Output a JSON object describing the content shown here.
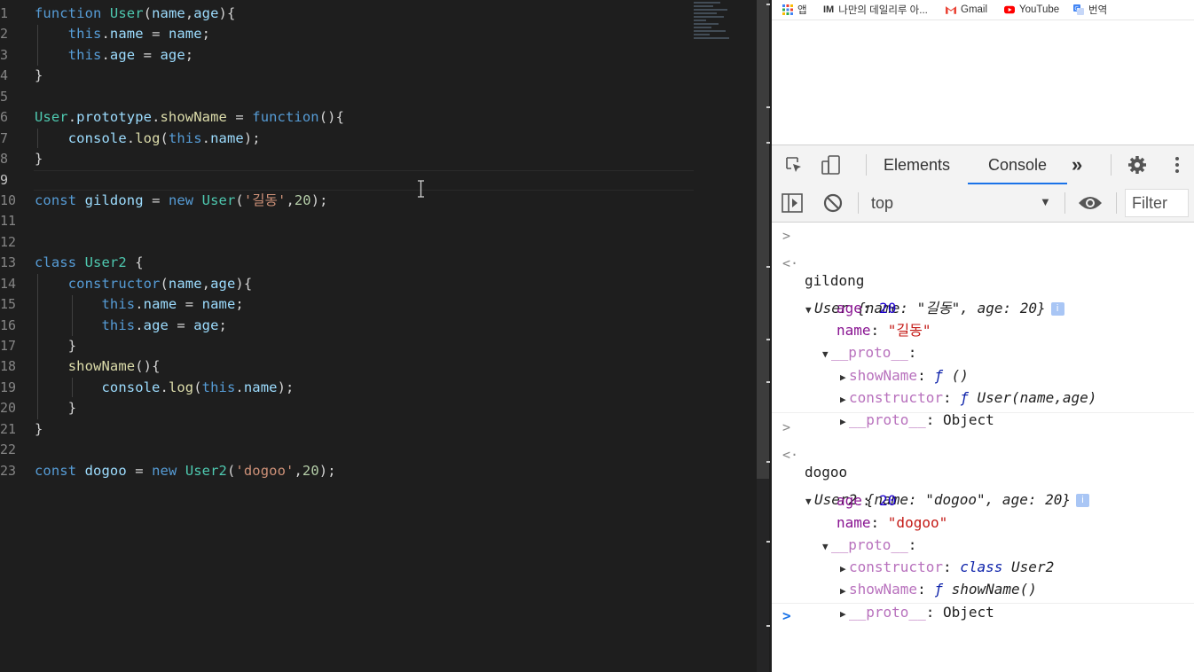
{
  "editor": {
    "line_numbers": [
      "1",
      "2",
      "3",
      "4",
      "5",
      "6",
      "7",
      "8",
      "9",
      "10",
      "11",
      "12",
      "13",
      "14",
      "15",
      "16",
      "17",
      "18",
      "19",
      "20",
      "21",
      "22",
      "23"
    ],
    "lines": [
      [
        [
          "kw",
          "function"
        ],
        [
          "t",
          " "
        ],
        [
          "cls",
          "User"
        ],
        [
          "t",
          "("
        ],
        [
          "var",
          "name"
        ],
        [
          "t",
          ","
        ],
        [
          "var",
          "age"
        ],
        [
          "t",
          "){"
        ]
      ],
      [
        [
          "t",
          "    "
        ],
        [
          "kw",
          "this"
        ],
        [
          "t",
          "."
        ],
        [
          "var",
          "name"
        ],
        [
          "t",
          " = "
        ],
        [
          "var",
          "name"
        ],
        [
          "t",
          ";"
        ]
      ],
      [
        [
          "t",
          "    "
        ],
        [
          "kw",
          "this"
        ],
        [
          "t",
          "."
        ],
        [
          "var",
          "age"
        ],
        [
          "t",
          " = "
        ],
        [
          "var",
          "age"
        ],
        [
          "t",
          ";"
        ]
      ],
      [
        [
          "t",
          "}"
        ]
      ],
      [],
      [
        [
          "cls",
          "User"
        ],
        [
          "t",
          "."
        ],
        [
          "var",
          "prototype"
        ],
        [
          "t",
          "."
        ],
        [
          "fn",
          "showName"
        ],
        [
          "t",
          " = "
        ],
        [
          "kw",
          "function"
        ],
        [
          "t",
          "(){"
        ]
      ],
      [
        [
          "t",
          "    "
        ],
        [
          "var",
          "console"
        ],
        [
          "t",
          "."
        ],
        [
          "fn",
          "log"
        ],
        [
          "t",
          "("
        ],
        [
          "kw",
          "this"
        ],
        [
          "t",
          "."
        ],
        [
          "var",
          "name"
        ],
        [
          "t",
          ");"
        ]
      ],
      [
        [
          "t",
          "}"
        ]
      ],
      [],
      [
        [
          "kw",
          "const"
        ],
        [
          "t",
          " "
        ],
        [
          "var",
          "gildong"
        ],
        [
          "t",
          " = "
        ],
        [
          "kw",
          "new"
        ],
        [
          "t",
          " "
        ],
        [
          "cls",
          "User"
        ],
        [
          "t",
          "("
        ],
        [
          "str",
          "'길동'"
        ],
        [
          "t",
          ","
        ],
        [
          "num",
          "20"
        ],
        [
          "t",
          ");"
        ]
      ],
      [],
      [],
      [
        [
          "kw",
          "class"
        ],
        [
          "t",
          " "
        ],
        [
          "cls",
          "User2"
        ],
        [
          "t",
          " {"
        ]
      ],
      [
        [
          "t",
          "    "
        ],
        [
          "kw",
          "constructor"
        ],
        [
          "t",
          "("
        ],
        [
          "var",
          "name"
        ],
        [
          "t",
          ","
        ],
        [
          "var",
          "age"
        ],
        [
          "t",
          "){"
        ]
      ],
      [
        [
          "t",
          "        "
        ],
        [
          "kw",
          "this"
        ],
        [
          "t",
          "."
        ],
        [
          "var",
          "name"
        ],
        [
          "t",
          " = "
        ],
        [
          "var",
          "name"
        ],
        [
          "t",
          ";"
        ]
      ],
      [
        [
          "t",
          "        "
        ],
        [
          "kw",
          "this"
        ],
        [
          "t",
          "."
        ],
        [
          "var",
          "age"
        ],
        [
          "t",
          " = "
        ],
        [
          "var",
          "age"
        ],
        [
          "t",
          ";"
        ]
      ],
      [
        [
          "t",
          "    }"
        ]
      ],
      [
        [
          "t",
          "    "
        ],
        [
          "fn",
          "showName"
        ],
        [
          "t",
          "(){"
        ]
      ],
      [
        [
          "t",
          "        "
        ],
        [
          "var",
          "console"
        ],
        [
          "t",
          "."
        ],
        [
          "fn",
          "log"
        ],
        [
          "t",
          "("
        ],
        [
          "kw",
          "this"
        ],
        [
          "t",
          "."
        ],
        [
          "var",
          "name"
        ],
        [
          "t",
          ");"
        ]
      ],
      [
        [
          "t",
          "    }"
        ]
      ],
      [
        [
          "t",
          "}"
        ]
      ],
      [],
      [
        [
          "kw",
          "const"
        ],
        [
          "t",
          " "
        ],
        [
          "var",
          "dogoo"
        ],
        [
          "t",
          " = "
        ],
        [
          "kw",
          "new"
        ],
        [
          "t",
          " "
        ],
        [
          "cls",
          "User2"
        ],
        [
          "t",
          "("
        ],
        [
          "str",
          "'dogoo'"
        ],
        [
          "t",
          ","
        ],
        [
          "num",
          "20"
        ],
        [
          "t",
          ");"
        ]
      ]
    ],
    "current_line": 9
  },
  "bookmarks": {
    "apps": "앱",
    "blog": "나만의 데일리루 아...",
    "gmail": "Gmail",
    "youtube": "YouTube",
    "translate": "번역"
  },
  "devtools": {
    "tab_elements": "Elements",
    "tab_console": "Console",
    "more": "»",
    "context": "top",
    "filter_placeholder": "Filter"
  },
  "console": {
    "in1": "gildong",
    "obj1_head_class": "User",
    "obj1_head_rest": " {name: \"길동\", age: 20}",
    "age_key": "age",
    "age_val": "20",
    "name_key": "name",
    "name_val1": "\"길동\"",
    "proto_key": "__proto__",
    "showName_key": "showName",
    "f_sym": "ƒ",
    "showName_sig1": " ()",
    "constructor_key": "constructor",
    "constructor_sig1": " User(name,age)",
    "object_val": "Object",
    "in2": "dogoo",
    "obj2_head_class": "User2",
    "obj2_head_rest": " {name: \"dogoo\", age: 20}",
    "name_val2": "\"dogoo\"",
    "class_kw": "class",
    "constructor_sig2": " User2",
    "showName_sig2": " showName()",
    "info": "i"
  },
  "colors": {
    "editor_bg": "#1e1e1e",
    "accent": "#1a73e8"
  }
}
